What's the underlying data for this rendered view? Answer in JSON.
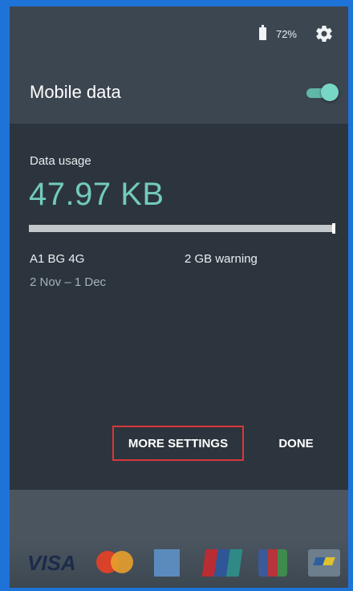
{
  "status": {
    "battery": "72%"
  },
  "header": {
    "title": "Mobile data",
    "toggle_on": true
  },
  "usage": {
    "label": "Data usage",
    "value": "47.97 KB",
    "bar_fill_fraction": 0.0,
    "carrier": "A1 BG 4G",
    "warning": "2 GB warning",
    "period": "2 Nov – 1 Dec"
  },
  "actions": {
    "more_settings": "MORE SETTINGS",
    "done": "DONE"
  },
  "payments": {
    "visa": "VISA"
  },
  "colors": {
    "accent": "#73cbbb",
    "highlight_border": "#d9363a"
  }
}
